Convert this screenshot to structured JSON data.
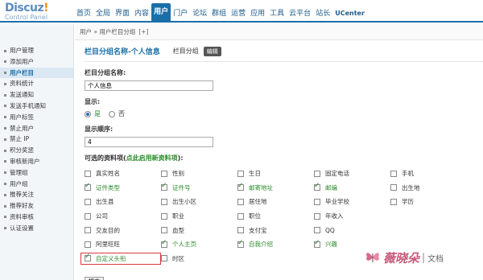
{
  "logo": {
    "main": "Discuz",
    "bang": "!",
    "sub": "Control Panel"
  },
  "topnav": [
    "首页",
    "全局",
    "界面",
    "内容",
    "用户",
    "门户",
    "论坛",
    "群组",
    "运营",
    "应用",
    "工具",
    "云平台",
    "站长",
    "UCenter"
  ],
  "topnav_active": 4,
  "sidebar": [
    "用户管理",
    "添加用户",
    "用户栏目",
    "资料统计",
    "发送通知",
    "发送手机通知",
    "用户标签",
    "禁止用户",
    "禁止 IP",
    "积分奖惩",
    "审核新用户",
    "管理组",
    "用户组",
    "推荐关注",
    "推荐好友",
    "资料审核",
    "认证设置"
  ],
  "sidebar_active": 2,
  "breadcrumb": {
    "text": "用户 » 用户栏目分组",
    "plus": "[+]"
  },
  "title_bar": {
    "title": "栏目分组名称-个人信息",
    "sub": "栏目分组",
    "badge": "编辑"
  },
  "form": {
    "name_label": "栏目分组名称:",
    "name_value": "个人信息",
    "show_label": "显示:",
    "yes": "是",
    "no": "否",
    "order_label": "显示顺序:",
    "order_value": "4",
    "fields_label_prefix": "可选的资料项(",
    "fields_label_link": "点此启用新资料项",
    "fields_label_suffix": "):",
    "submit": "提交"
  },
  "fields": [
    {
      "label": "真实姓名",
      "checked": false
    },
    {
      "label": "性别",
      "checked": false
    },
    {
      "label": "生日",
      "checked": false
    },
    {
      "label": "固定电话",
      "checked": false
    },
    {
      "label": "手机",
      "checked": false
    },
    {
      "label": "证件类型",
      "checked": true
    },
    {
      "label": "证件号",
      "checked": true
    },
    {
      "label": "邮寄地址",
      "checked": true
    },
    {
      "label": "邮编",
      "checked": true
    },
    {
      "label": "出生地",
      "checked": false
    },
    {
      "label": "出生县",
      "checked": false
    },
    {
      "label": "出生小区",
      "checked": false
    },
    {
      "label": "居住地",
      "checked": false
    },
    {
      "label": "毕业学校",
      "checked": false
    },
    {
      "label": "学历",
      "checked": false
    },
    {
      "label": "公司",
      "checked": false
    },
    {
      "label": "职业",
      "checked": false
    },
    {
      "label": "职位",
      "checked": false
    },
    {
      "label": "年收入",
      "checked": false
    },
    {
      "label": "",
      "checked": false
    },
    {
      "label": "交友目的",
      "checked": false
    },
    {
      "label": "血型",
      "checked": false
    },
    {
      "label": "支付宝",
      "checked": false
    },
    {
      "label": "QQ",
      "checked": false
    },
    {
      "label": "",
      "checked": false
    },
    {
      "label": "阿里旺旺",
      "checked": false
    },
    {
      "label": "个人主页",
      "checked": true
    },
    {
      "label": "自我介绍",
      "checked": true
    },
    {
      "label": "兴趣",
      "checked": true
    },
    {
      "label": "",
      "checked": false
    },
    {
      "label": "自定义头衔",
      "checked": true,
      "highlight": true
    },
    {
      "label": "时区",
      "checked": false
    }
  ],
  "watermark": {
    "text": "薇晓朵",
    "sep": "|",
    "doc": "文档"
  }
}
